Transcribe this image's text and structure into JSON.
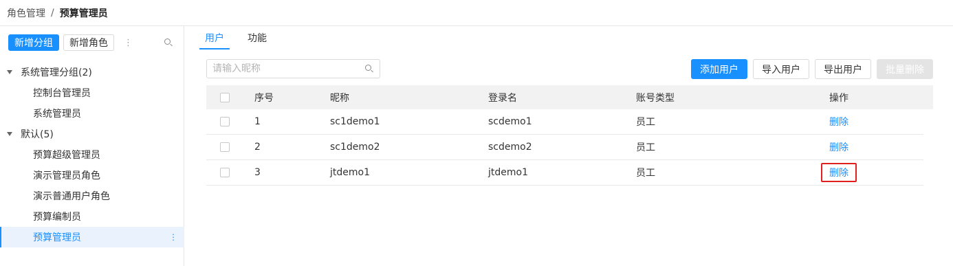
{
  "breadcrumb": {
    "parent": "角色管理",
    "separator": "/",
    "current": "预算管理员"
  },
  "sidebar": {
    "add_group_label": "新增分组",
    "add_role_label": "新增角色",
    "more_glyph": "⋮",
    "tree": [
      {
        "group": "系统管理分组(2)",
        "items": [
          "控制台管理员",
          "系统管理员"
        ]
      },
      {
        "group": "默认(5)",
        "items": [
          "预算超级管理员",
          "演示管理员角色",
          "演示普通用户角色",
          "预算编制员",
          "预算管理员"
        ]
      }
    ],
    "active_item": "预算管理员",
    "active_item_kebab": "⋮"
  },
  "tabs": [
    {
      "label": "用户"
    },
    {
      "label": "功能"
    }
  ],
  "search": {
    "placeholder": "请输入昵称",
    "value": ""
  },
  "actions": {
    "add_user": "添加用户",
    "import_users": "导入用户",
    "export_users": "导出用户",
    "batch_delete": "批量删除"
  },
  "table": {
    "headers": {
      "no": "序号",
      "nickname": "昵称",
      "login": "登录名",
      "account_type": "账号类型",
      "operation": "操作"
    },
    "rows": [
      {
        "no": "1",
        "nickname": "sc1demo1",
        "login": "scdemo1",
        "account_type": "员工",
        "action": "删除"
      },
      {
        "no": "2",
        "nickname": "sc1demo2",
        "login": "scdemo2",
        "account_type": "员工",
        "action": "删除"
      },
      {
        "no": "3",
        "nickname": "jtdemo1",
        "login": "jtdemo1",
        "account_type": "员工",
        "action": "删除"
      }
    ]
  },
  "colors": {
    "primary": "#1890ff",
    "highlight_border": "#e0201c",
    "disabled_button": "#e4e4e4"
  }
}
